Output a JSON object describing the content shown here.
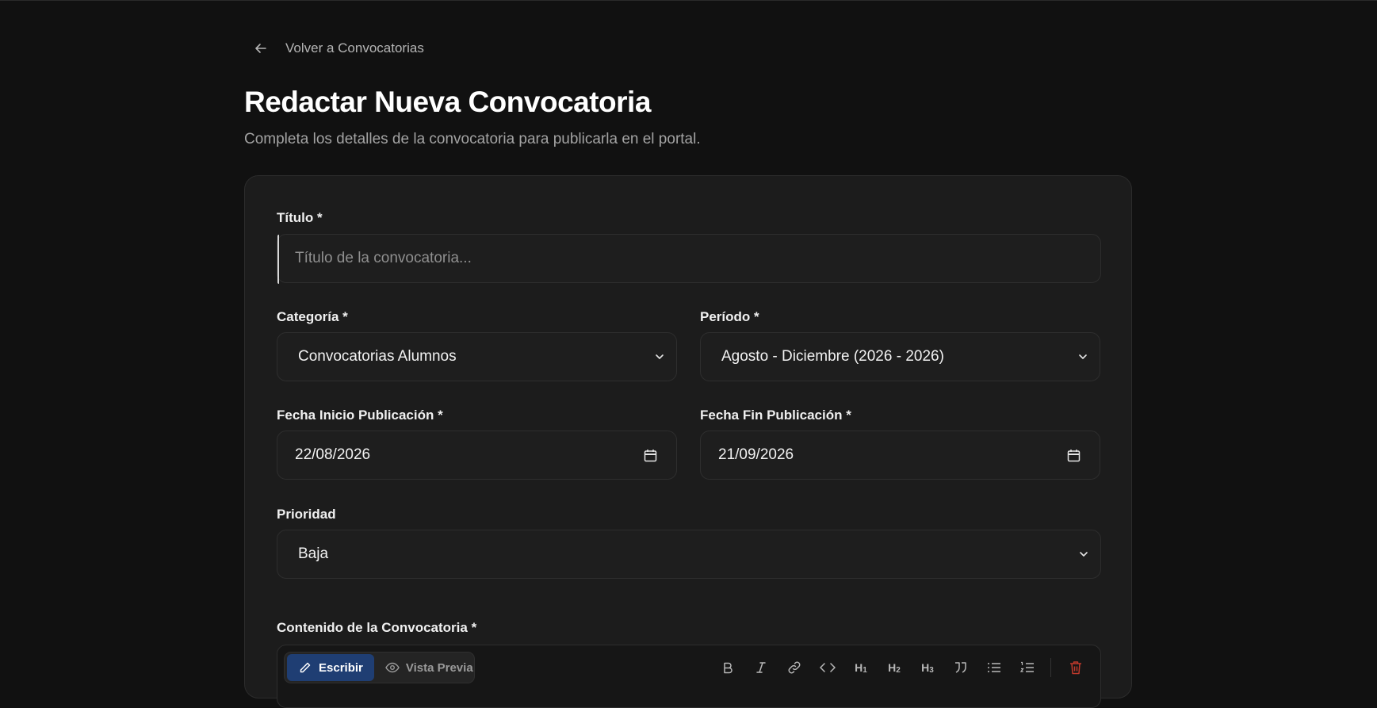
{
  "back_link": {
    "label": "Volver a Convocatorias",
    "icon": "arrow-left-icon"
  },
  "header": {
    "title": "Redactar Nueva Convocatoria",
    "subtitle": "Completa los detalles de la convocatoria para publicarla en el portal."
  },
  "form": {
    "titulo": {
      "label": "Título *",
      "value": "",
      "placeholder": "Título de la convocatoria..."
    },
    "categoria": {
      "label": "Categoría *",
      "selected": "Convocatorias Alumnos"
    },
    "periodo": {
      "label": "Período *",
      "selected": "Agosto - Diciembre (2026 - 2026)"
    },
    "fecha_inicio": {
      "label": "Fecha Inicio Publicación *",
      "value": "22/08/2026"
    },
    "fecha_fin": {
      "label": "Fecha Fin Publicación *",
      "value": "21/09/2026"
    },
    "prioridad": {
      "label": "Prioridad",
      "selected": "Baja"
    },
    "contenido": {
      "label": "Contenido de la Convocatoria *"
    }
  },
  "editor": {
    "tabs": [
      {
        "label": "Escribir",
        "icon": "pencil-icon",
        "active": true
      },
      {
        "label": "Vista Previa",
        "icon": "eye-icon",
        "active": false
      }
    ],
    "toolbar": [
      "bold-icon",
      "italic-icon",
      "link-icon",
      "code-icon",
      "heading-1-icon",
      "heading-2-icon",
      "heading-3-icon",
      "quote-icon",
      "bullet-list-icon",
      "numbered-list-icon",
      "trash-icon"
    ],
    "headings": {
      "h1": "H",
      "h1_sub": "1",
      "h2": "H",
      "h2_sub": "2",
      "h3": "H",
      "h3_sub": "3"
    }
  },
  "colors": {
    "background": "#111111",
    "card": "#1c1c1c",
    "accent": "#1f3e73",
    "danger": "#c0392b"
  }
}
